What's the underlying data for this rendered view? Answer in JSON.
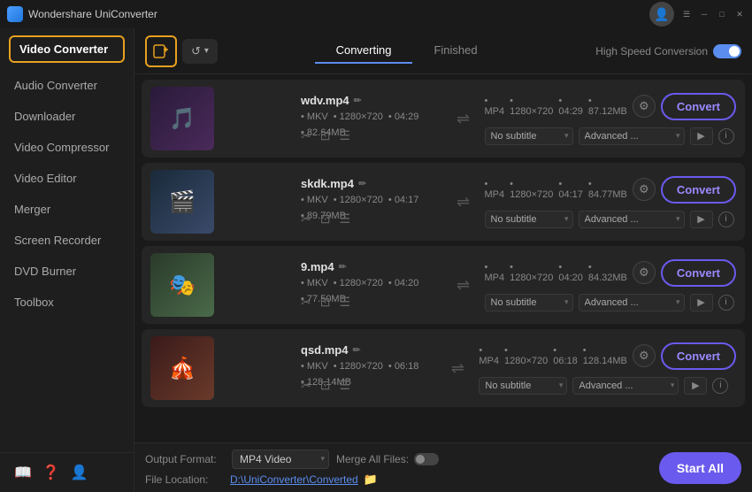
{
  "app": {
    "name": "Wondershare UniConverter",
    "icon": "⚡"
  },
  "window_controls": {
    "menu": "☰",
    "minimize": "─",
    "restore": "□",
    "close": "✕"
  },
  "sidebar": {
    "active_item": "Video Converter",
    "items": [
      {
        "label": "Video Converter",
        "active": true
      },
      {
        "label": "Audio Converter"
      },
      {
        "label": "Downloader"
      },
      {
        "label": "Video Compressor"
      },
      {
        "label": "Video Editor"
      },
      {
        "label": "Merger"
      },
      {
        "label": "Screen Recorder"
      },
      {
        "label": "DVD Burner"
      },
      {
        "label": "Toolbox"
      }
    ],
    "footer_icons": [
      "book",
      "help",
      "user"
    ]
  },
  "top_bar": {
    "add_files_icon": "+",
    "rotate_icon": "↺",
    "tabs": [
      {
        "label": "Converting",
        "active": true
      },
      {
        "label": "Finished",
        "active": false
      }
    ],
    "speed_label": "High Speed Conversion",
    "user_icon": "👤",
    "menu_icon": "☰"
  },
  "files": [
    {
      "name": "wdv.mp4",
      "thumb_class": "thumb-1",
      "thumb_emoji": "🎵",
      "input_format": "MKV",
      "input_resolution": "1280×720",
      "input_duration": "04:29",
      "input_size": "82.64MB",
      "output_format": "MP4",
      "output_resolution": "1280×720",
      "output_duration": "04:29",
      "output_size": "87.12MB",
      "subtitle": "No subtitle",
      "advanced": "Advanced ...",
      "convert_label": "Convert"
    },
    {
      "name": "skdk.mp4",
      "thumb_class": "thumb-2",
      "thumb_emoji": "🎬",
      "input_format": "MKV",
      "input_resolution": "1280×720",
      "input_duration": "04:17",
      "input_size": "89.79MB",
      "output_format": "MP4",
      "output_resolution": "1280×720",
      "output_duration": "04:17",
      "output_size": "84.77MB",
      "subtitle": "No subtitle",
      "advanced": "Advanced ...",
      "convert_label": "Convert"
    },
    {
      "name": "9.mp4",
      "thumb_class": "thumb-3",
      "thumb_emoji": "🎭",
      "input_format": "MKV",
      "input_resolution": "1280×720",
      "input_duration": "04:20",
      "input_size": "77.50MB",
      "output_format": "MP4",
      "output_resolution": "1280×720",
      "output_duration": "04:20",
      "output_size": "84.32MB",
      "subtitle": "No subtitle",
      "advanced": "Advanced ...",
      "convert_label": "Convert"
    },
    {
      "name": "qsd.mp4",
      "thumb_class": "thumb-4",
      "thumb_emoji": "🎪",
      "input_format": "MKV",
      "input_resolution": "1280×720",
      "input_duration": "06:18",
      "input_size": "128.14MB",
      "output_format": "MP4",
      "output_resolution": "1280×720",
      "output_duration": "06:18",
      "output_size": "128.14MB",
      "subtitle": "No subtitle",
      "advanced": "Advanced ...",
      "convert_label": "Convert"
    }
  ],
  "bottom_bar": {
    "output_format_label": "Output Format:",
    "output_format_value": "MP4 Video",
    "merge_label": "Merge All Files:",
    "file_location_label": "File Location:",
    "file_location_path": "D:\\UniConverter\\Converted",
    "start_all_label": "Start All"
  }
}
